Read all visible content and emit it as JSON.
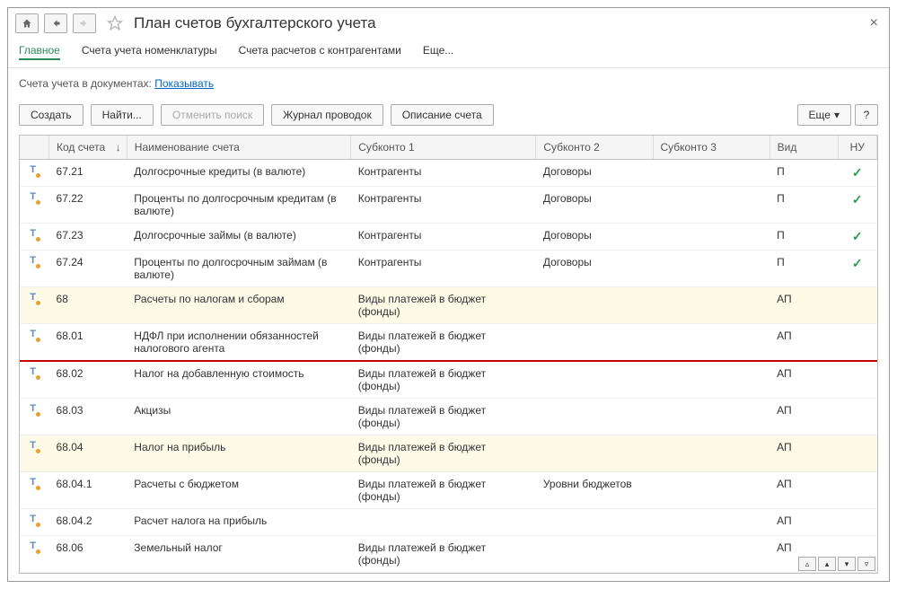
{
  "header": {
    "title": "План счетов бухгалтерского учета"
  },
  "tabs": [
    {
      "label": "Главное",
      "active": true
    },
    {
      "label": "Счета учета номенклатуры",
      "active": false
    },
    {
      "label": "Счета расчетов с контрагентами",
      "active": false
    },
    {
      "label": "Еще...",
      "active": false
    }
  ],
  "subheader": {
    "text": "Счета учета в документах:",
    "link": "Показывать"
  },
  "toolbar": {
    "create": "Создать",
    "find": "Найти...",
    "cancel_search": "Отменить поиск",
    "journal": "Журнал проводок",
    "description": "Описание счета",
    "more": "Еще",
    "help": "?"
  },
  "columns": {
    "code": "Код счета",
    "name": "Наименование счета",
    "sub1": "Субконто 1",
    "sub2": "Субконто 2",
    "sub3": "Субконто 3",
    "vid": "Вид",
    "nu": "НУ"
  },
  "rows": [
    {
      "code": "67.21",
      "name": "Долгосрочные кредиты (в валюте)",
      "sub1": "Контрагенты",
      "sub2": "Договоры",
      "sub3": "",
      "vid": "П",
      "nu": true
    },
    {
      "code": "67.22",
      "name": "Проценты по долгосрочным кредитам (в валюте)",
      "sub1": "Контрагенты",
      "sub2": "Договоры",
      "sub3": "",
      "vid": "П",
      "nu": true
    },
    {
      "code": "67.23",
      "name": "Долгосрочные займы (в валюте)",
      "sub1": "Контрагенты",
      "sub2": "Договоры",
      "sub3": "",
      "vid": "П",
      "nu": true
    },
    {
      "code": "67.24",
      "name": "Проценты по долгосрочным займам (в валюте)",
      "sub1": "Контрагенты",
      "sub2": "Договоры",
      "sub3": "",
      "vid": "П",
      "nu": true
    },
    {
      "code": "68",
      "name": "Расчеты по налогам и сборам",
      "sub1": "Виды платежей в бюджет (фонды)",
      "sub2": "",
      "sub3": "",
      "vid": "АП",
      "nu": false,
      "highlight": true
    },
    {
      "code": "68.01",
      "name": "НДФЛ при исполнении обязанностей налогового агента",
      "sub1": "Виды платежей в бюджет (фонды)",
      "sub2": "",
      "sub3": "",
      "vid": "АП",
      "nu": false
    },
    {
      "code": "68.02",
      "name": "Налог на добавленную стоимость",
      "sub1": "Виды платежей в бюджет (фонды)",
      "sub2": "",
      "sub3": "",
      "vid": "АП",
      "nu": false,
      "redline": true
    },
    {
      "code": "68.03",
      "name": "Акцизы",
      "sub1": "Виды платежей в бюджет (фонды)",
      "sub2": "",
      "sub3": "",
      "vid": "АП",
      "nu": false
    },
    {
      "code": "68.04",
      "name": "Налог на прибыль",
      "sub1": "Виды платежей в бюджет (фонды)",
      "sub2": "",
      "sub3": "",
      "vid": "АП",
      "nu": false,
      "highlight": true
    },
    {
      "code": "68.04.1",
      "name": "Расчеты с бюджетом",
      "sub1": "Виды платежей в бюджет (фонды)",
      "sub2": "Уровни бюджетов",
      "sub3": "",
      "vid": "АП",
      "nu": false
    },
    {
      "code": "68.04.2",
      "name": "Расчет налога на прибыль",
      "sub1": "",
      "sub2": "",
      "sub3": "",
      "vid": "АП",
      "nu": false
    },
    {
      "code": "68.06",
      "name": "Земельный налог",
      "sub1": "Виды платежей в бюджет (фонды)",
      "sub2": "",
      "sub3": "",
      "vid": "АП",
      "nu": false
    }
  ]
}
